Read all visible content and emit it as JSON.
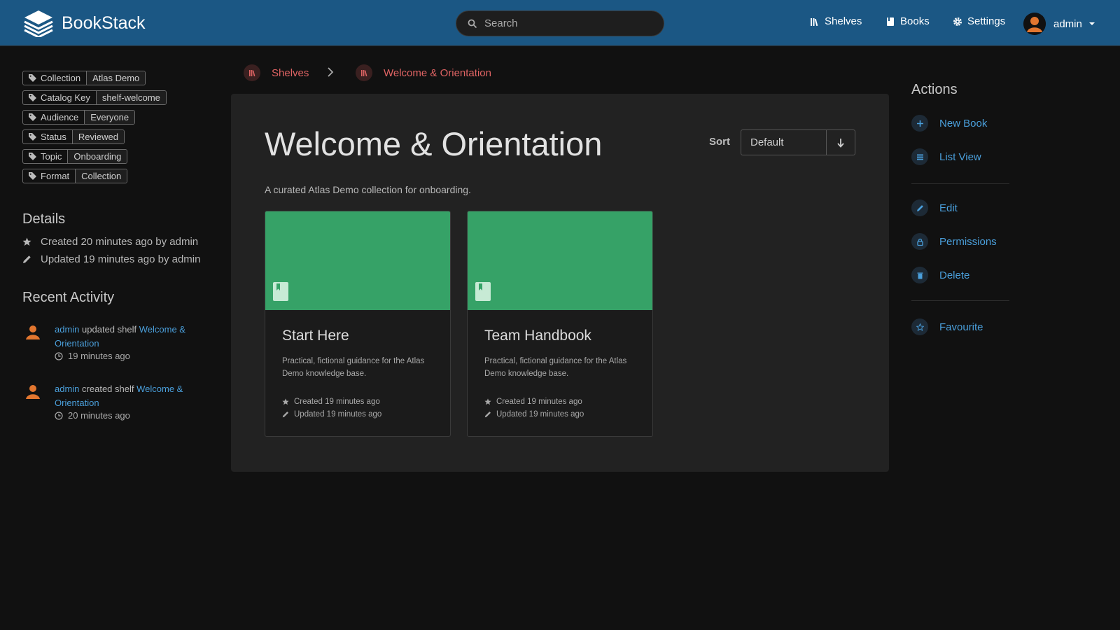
{
  "app": {
    "name": "BookStack"
  },
  "header": {
    "search_placeholder": "Search",
    "nav": [
      {
        "label": "Shelves",
        "icon": "shelves-icon"
      },
      {
        "label": "Books",
        "icon": "book-icon"
      },
      {
        "label": "Settings",
        "icon": "gear-icon"
      }
    ],
    "user": {
      "name": "admin"
    }
  },
  "tags": [
    {
      "key": "Collection",
      "value": "Atlas Demo"
    },
    {
      "key": "Catalog Key",
      "value": "shelf-welcome"
    },
    {
      "key": "Audience",
      "value": "Everyone"
    },
    {
      "key": "Status",
      "value": "Reviewed"
    },
    {
      "key": "Topic",
      "value": "Onboarding"
    },
    {
      "key": "Format",
      "value": "Collection"
    }
  ],
  "details": {
    "title": "Details",
    "created": "Created 20 minutes ago by admin",
    "updated": "Updated 19 minutes ago by admin"
  },
  "recent_activity": {
    "title": "Recent Activity",
    "items": [
      {
        "user": "admin",
        "action": "updated shelf",
        "target": "Welcome & Orientation",
        "time": "19 minutes ago"
      },
      {
        "user": "admin",
        "action": "created shelf",
        "target": "Welcome & Orientation",
        "time": "20 minutes ago"
      }
    ]
  },
  "breadcrumb": [
    {
      "label": "Shelves"
    },
    {
      "label": "Welcome & Orientation"
    }
  ],
  "shelf": {
    "title": "Welcome & Orientation",
    "description": "A curated Atlas Demo collection for onboarding.",
    "sort_label": "Sort",
    "sort_value": "Default"
  },
  "books": [
    {
      "title": "Start Here",
      "description": "Practical, fictional guidance for the Atlas Demo knowledge base.",
      "created": "Created 19 minutes ago",
      "updated": "Updated 19 minutes ago"
    },
    {
      "title": "Team Handbook",
      "description": "Practical, fictional guidance for the Atlas Demo knowledge base.",
      "created": "Created 19 minutes ago",
      "updated": "Updated 19 minutes ago"
    }
  ],
  "actions": {
    "title": "Actions",
    "items": [
      {
        "label": "New Book",
        "icon": "plus-icon"
      },
      {
        "label": "List View",
        "icon": "list-icon"
      },
      {
        "label": "Edit",
        "icon": "pencil-icon"
      },
      {
        "label": "Permissions",
        "icon": "lock-icon"
      },
      {
        "label": "Delete",
        "icon": "trash-icon"
      },
      {
        "label": "Favourite",
        "icon": "star-icon"
      }
    ]
  },
  "colors": {
    "header": "#1b5784",
    "background": "#111111",
    "panel": "#222222",
    "book_cover": "#36a267",
    "link": "#4a9fdb",
    "shelf_accent": "#e06464",
    "avatar": "#e2762f"
  }
}
